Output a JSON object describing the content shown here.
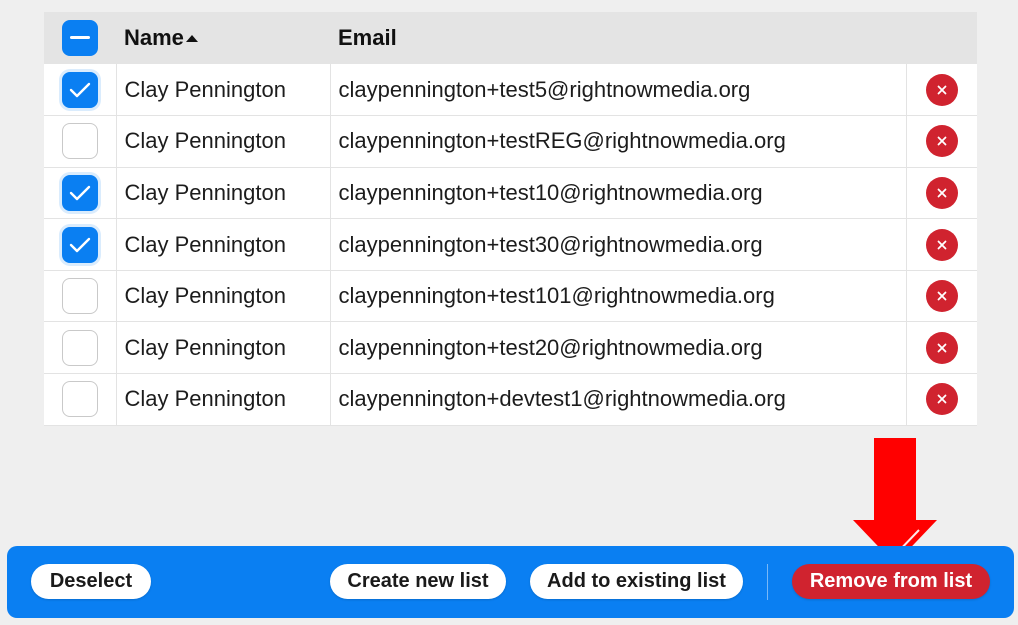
{
  "table": {
    "headers": {
      "name": "Name",
      "email": "Email"
    },
    "rows": [
      {
        "name": "Clay Pennington",
        "email": "claypennington+test5@rightnowmedia.org",
        "checked": true
      },
      {
        "name": "Clay Pennington",
        "email": "claypennington+testREG@rightnowmedia.org",
        "checked": false
      },
      {
        "name": "Clay Pennington",
        "email": "claypennington+test10@rightnowmedia.org",
        "checked": true
      },
      {
        "name": "Clay Pennington",
        "email": "claypennington+test30@rightnowmedia.org",
        "checked": true
      },
      {
        "name": "Clay Pennington",
        "email": "claypennington+test101@rightnowmedia.org",
        "checked": false
      },
      {
        "name": "Clay Pennington",
        "email": "claypennington+test20@rightnowmedia.org",
        "checked": false
      },
      {
        "name": "Clay Pennington",
        "email": "claypennington+devtest1@rightnowmedia.org",
        "checked": false
      }
    ],
    "select_all_state": "indeterminate",
    "sort": {
      "column": "name",
      "direction": "ascending"
    },
    "row_action_icon": "close-icon"
  },
  "toolbar": {
    "deselect_label": "Deselect",
    "create_list_label": "Create new list",
    "add_existing_label": "Add to existing list",
    "remove_label": "Remove from list"
  },
  "colors": {
    "accent": "#0a7ff2",
    "danger": "#d0232f",
    "annotation": "#ff0000",
    "background": "#efefef"
  }
}
